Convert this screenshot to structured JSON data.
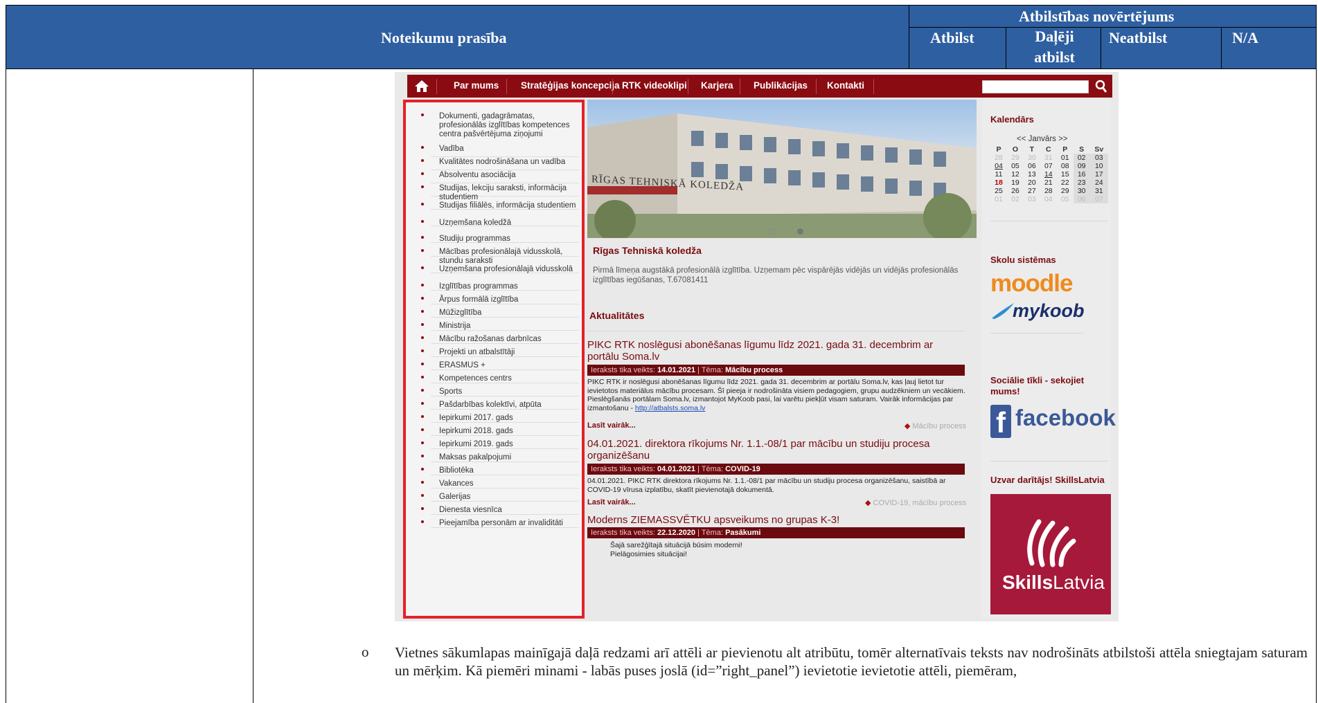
{
  "header": {
    "rule_col": "Noteikumu prasība",
    "assessment_title": "Atbilstības novērtējums",
    "col_atbilst": "Atbilst",
    "col_dalji": "Daļēji atbilst",
    "col_neatbilst": "Neatbilst",
    "col_na": "N/A"
  },
  "site": {
    "nav": [
      "Par mums",
      "Stratēģijas koncepcija",
      "RTK videoklipi",
      "Karjera",
      "Publikācijas",
      "Kontakti"
    ],
    "menu": [
      "Dokumenti, gadagrāmatas, profesionālās izglītības kompetences centra pašvērtējuma ziņojumi",
      "Vadība",
      "Kvalitātes nodrošināšana un vadība",
      "Absolventu asociācija",
      "Studijas, lekciju saraksti, informācija studentiem",
      "Studijas filiālēs, informācija studentiem",
      "Uzņemšana koledžā",
      "Studiju programmas",
      "Mācības profesionālajā vidusskolā, stundu saraksti",
      "Uzņemšana profesionālajā vidusskolā",
      "Izglītības programmas",
      "Ārpus formālā izglītība",
      "Mūžizglītība",
      "Ministrija",
      "Mācību ražošanas darbnīcas",
      "Projekti un atbalstītāji",
      "ERASMUS +",
      "Kompetences centrs",
      "Sports",
      "Pašdarbības kolektīvi, atpūta",
      "Iepirkumi 2017. gads",
      "Iepirkumi 2018. gads",
      "Iepirkumi 2019. gads",
      "Maksas pakalpojumi",
      "Bibliotēka",
      "Vakances",
      "Galerijas",
      "Dienesta viesnīca",
      "Pieejamība personām ar invaliditāti"
    ],
    "hero_sign": "RĪGAS TEHNISKĀ KOLEDŽA",
    "college_title": "Rīgas Tehniskā koledža",
    "college_desc": "Pirmā līmeņa augstākā profesionālā izglītība. Uzņemam pēc vispārējās vidējās un vidējās profesionālās izglītības iegūšanas, T.67081411",
    "news_heading": "Aktualitātes",
    "posts": [
      {
        "title": "PIKC RTK noslēgusi abonēšanas līgumu līdz 2021. gada 31. decembrim ar portālu Soma.lv",
        "meta_label": "Ieraksts tika veikts:",
        "date": "14.01.2021",
        "theme_label": "| Tēma:",
        "theme": "Mācību process",
        "body": "PIKC RTK ir noslēgusi abonēšanas līgumu līdz 2021. gada 31. decembrim ar portālu Soma.lv, kas ļauj lietot tur ievietotos materiālus mācību procesam. Šī pieeja ir nodrošināta visiem pedagogiem, grupu audzēkniem un vecākiem. Pieslēgšanās portālam Soma.lv, izmantojot MyKoob pasi, lai varētu piekļūt visam saturam. Vairāk informācijas par izmantošanu -",
        "link": "http://atbalsts.soma.lv",
        "readmore": "Lasīt vairāk...",
        "tag": "Mācību process"
      },
      {
        "title": "04.01.2021. direktora rīkojums Nr. 1.1.-08/1 par mācību un studiju procesa organizēšanu",
        "meta_label": "Ieraksts tika veikts:",
        "date": "04.01.2021",
        "theme_label": "| Tēma:",
        "theme": "COVID-19",
        "body": "04.01.2021. PIKC RTK direktora rīkojums Nr. 1.1.-08/1 par mācību un studiju procesa organizēšanu, saistībā ar COVID-19 vīrusa izplatību, skatīt pievienotajā dokumentā.",
        "readmore": "Lasīt vairāk...",
        "tag": "COVID-19, mācību process"
      },
      {
        "title": "Moderns ZIEMASSVĒTKU apsveikums no grupas K-3!",
        "meta_label": "Ieraksts tika veikts:",
        "date": "22.12.2020",
        "theme_label": "| Tēma:",
        "theme": "Pasākumi",
        "body1": "Šajā sarežģītajā situācijā būsim moderni!",
        "body2": "Pielāgosimies situācijai!"
      }
    ],
    "calendar": {
      "title": "Kalendārs",
      "month_nav": "<< Janvārs >>",
      "weekdays": [
        "P",
        "O",
        "T",
        "C",
        "P",
        "S",
        "Sv"
      ],
      "weeks": [
        [
          "28",
          "29",
          "30",
          "31",
          "01",
          "02",
          "03"
        ],
        [
          "04",
          "05",
          "06",
          "07",
          "08",
          "09",
          "10"
        ],
        [
          "11",
          "12",
          "13",
          "14",
          "15",
          "16",
          "17"
        ],
        [
          "18",
          "19",
          "20",
          "21",
          "22",
          "23",
          "24"
        ],
        [
          "25",
          "26",
          "27",
          "28",
          "29",
          "30",
          "31"
        ],
        [
          "01",
          "02",
          "03",
          "04",
          "05",
          "06",
          "07"
        ]
      ]
    },
    "school_systems": "Skolu sistēmas",
    "moodle": "moodle",
    "mykoob": "mykoob",
    "social": "Sociālie tīkli - sekojiet mums!",
    "facebook": "facebook",
    "skills_heading": "Uzvar darītājs! SkillsLatvia",
    "skills_logo_a": "Skills",
    "skills_logo_b": "Latvia"
  },
  "paragraph": {
    "bullet": "o",
    "text": "Vietnes sākumlapas mainīgajā daļā redzami arī attēli ar pievienotu alt atribūtu, tomēr alternatīvais teksts nav nodrošināts atbilstoši attēla sniegtajam saturam un mērķim. Kā piemēri minami - labās puses joslā (id=”right_panel”) ievietotie ievietotie attēli, piemēram,"
  }
}
